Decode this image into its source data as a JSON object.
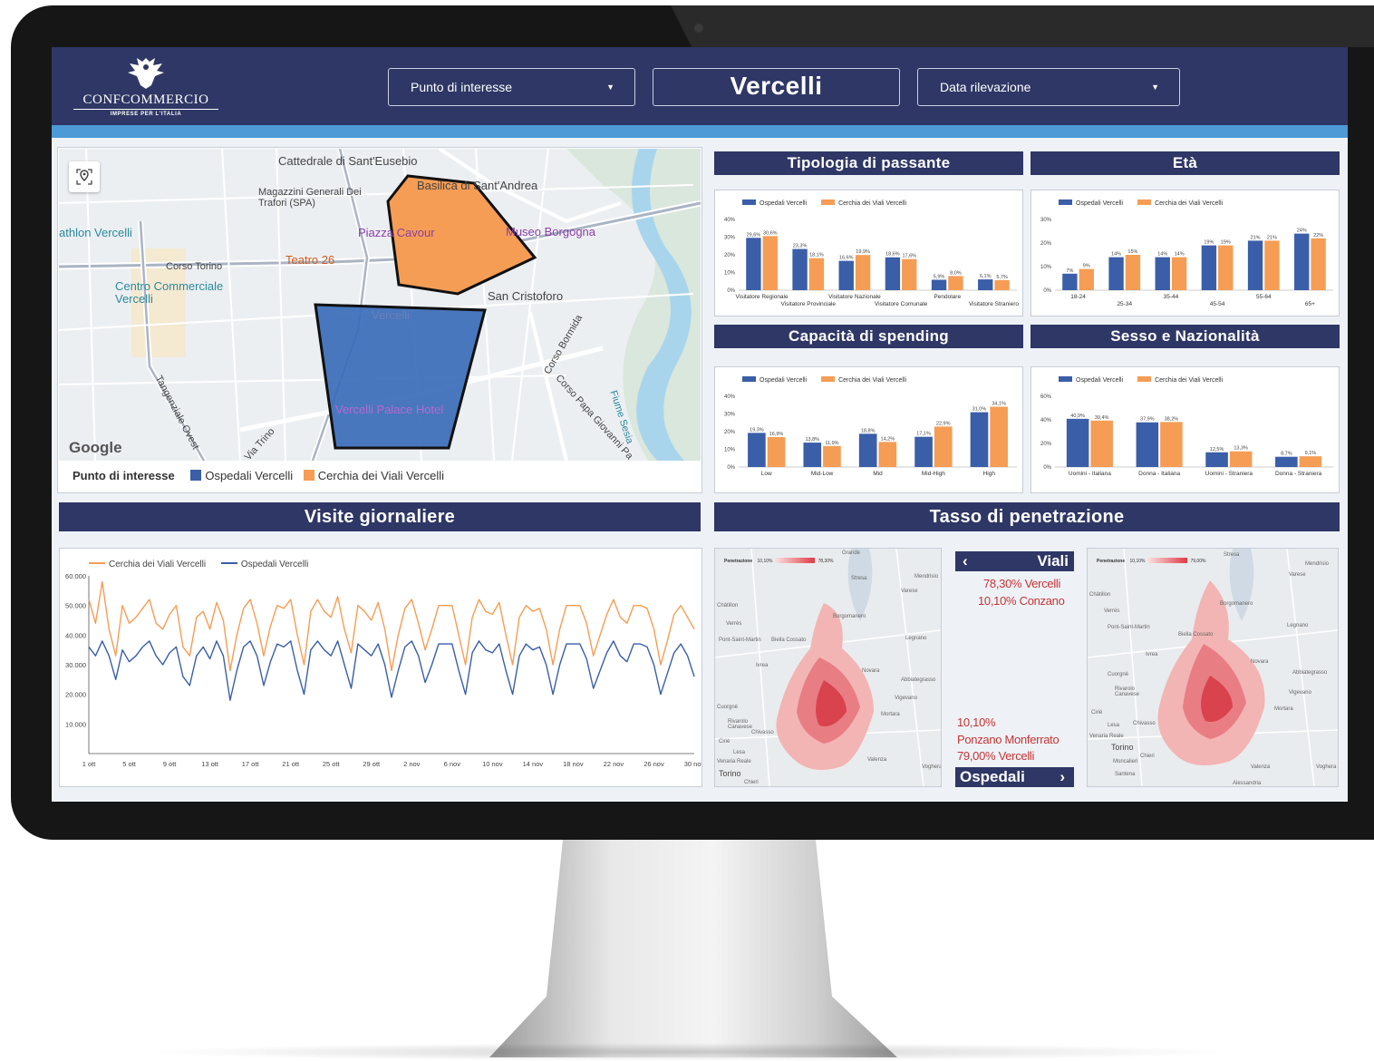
{
  "header": {
    "logo_name": "CONFCOMMERCIO",
    "logo_sub": "IMPRESE PER L'ITALIA",
    "poi_dropdown": "Punto di interesse",
    "city": "Vercelli",
    "date_dropdown": "Data rilevazione"
  },
  "map": {
    "labels": {
      "cattedrale": "Cattedrale di Sant'Eusebio",
      "basilica": "Basilica di Sant'Andrea",
      "magazzini": "Magazzini Generali Dei Trafori (SPA)",
      "athlon": "athlon Vercelli",
      "piazza": "Piazza Cavour",
      "museo": "Museo Borgogna",
      "teatro": "Teatro 26",
      "corso_torino": "Corso Torino",
      "centro": "Centro Commerciale Vercelli",
      "san_cristoforo": "San Cristoforo",
      "vercelli": "Vercelli",
      "corso_bormida": "Corso Bormida",
      "tangenziale": "Tangenziale Ovest",
      "corso_papa": "Corso Papa Giovanni Pa",
      "fiume_sesia": "Fiume Sesia",
      "palace": "Vercelli Palace Hotel",
      "via_trino": "Via Trino",
      "google": "Google"
    },
    "legend_title": "Punto di interesse",
    "legend_ospedali": "Ospedali Vercelli",
    "legend_cerchia": "Cerchia dei Viali Vercelli"
  },
  "colors": {
    "blue": "#3a5ea8",
    "orange": "#f59d55",
    "navy": "#2e3765",
    "red": "#c43433"
  },
  "sections": {
    "tipologia": "Tipologia di passante",
    "eta": "Età",
    "spending": "Capacità di spending",
    "sesso": "Sesso e Nazionalità",
    "visite": "Visite giornaliere",
    "tasso": "Tasso di penetrazione"
  },
  "series_names": {
    "ospedali": "Ospedali Vercelli",
    "cerchia": "Cerchia dei Viali Vercelli"
  },
  "chart_data": [
    {
      "id": "tipologia",
      "type": "bar",
      "title": "Tipologia di passante",
      "categories": [
        "Visitatore Regionale",
        "Visitatore Provinciale",
        "Visitatore Nazionale",
        "Visitatore Comunale",
        "Pendolare",
        "Visitatore Straniero"
      ],
      "series": [
        {
          "name": "Ospedali Vercelli",
          "values": [
            29.6,
            23.3,
            16.6,
            18.6,
            5.9,
            6.1
          ],
          "labels": [
            "29,6%",
            "23,3%",
            "16,6%",
            "18,6%",
            "5,9%",
            "6,1%"
          ]
        },
        {
          "name": "Cerchia dei Viali Vercelli",
          "values": [
            30.6,
            18.1,
            19.9,
            17.6,
            8.0,
            5.7
          ],
          "labels": [
            "30,6%",
            "18,1%",
            "19,9%",
            "17,6%",
            "8,0%",
            "5,7%"
          ]
        }
      ],
      "yticks": [
        "0%",
        "10%",
        "20%",
        "30%",
        "40%"
      ],
      "ylim": [
        0,
        40
      ]
    },
    {
      "id": "eta",
      "type": "bar",
      "title": "Età",
      "categories": [
        "18-24",
        "25-34",
        "35-44",
        "45-54",
        "55-64",
        "65+"
      ],
      "series": [
        {
          "name": "Ospedali Vercelli",
          "values": [
            7,
            14,
            14,
            19,
            21,
            24
          ],
          "labels": [
            "7%",
            "14%",
            "14%",
            "19%",
            "21%",
            "24%"
          ]
        },
        {
          "name": "Cerchia dei Viali Vercelli",
          "values": [
            9,
            15,
            14,
            19,
            21,
            22
          ],
          "labels": [
            "9%",
            "15%",
            "14%",
            "19%",
            "21%",
            "22%"
          ]
        }
      ],
      "yticks": [
        "0%",
        "10%",
        "20%",
        "30%"
      ],
      "ylim": [
        0,
        30
      ]
    },
    {
      "id": "spending",
      "type": "bar",
      "title": "Capacità di spending",
      "categories": [
        "Low",
        "Mid-Low",
        "Mid",
        "Mid-High",
        "High"
      ],
      "series": [
        {
          "name": "Ospedali Vercelli",
          "values": [
            19.3,
            13.8,
            18.8,
            17.1,
            31.0
          ],
          "labels": [
            "19,3%",
            "13,8%",
            "18,8%",
            "17,1%",
            "31,0%"
          ]
        },
        {
          "name": "Cerchia dei Viali Vercelli",
          "values": [
            16.9,
            11.9,
            14.2,
            22.9,
            34.1
          ],
          "labels": [
            "16,9%",
            "11,9%",
            "14,2%",
            "22,9%",
            "34,1%"
          ]
        }
      ],
      "yticks": [
        "0%",
        "10%",
        "20%",
        "30%",
        "40%"
      ],
      "ylim": [
        0,
        40
      ]
    },
    {
      "id": "sesso",
      "type": "bar",
      "title": "Sesso e Nazionalità",
      "categories": [
        "Uomini - Italiana",
        "Donna - Italiana",
        "Uomini - Straniera",
        "Donna - Straniera"
      ],
      "series": [
        {
          "name": "Ospedali Vercelli",
          "values": [
            40.9,
            37.9,
            12.5,
            8.7
          ],
          "labels": [
            "40,9%",
            "37,9%",
            "12,5%",
            "8,7%"
          ]
        },
        {
          "name": "Cerchia dei Viali Vercelli",
          "values": [
            39.4,
            38.2,
            13.3,
            9.1
          ],
          "labels": [
            "39,4%",
            "38,2%",
            "13,3%",
            "9,1%"
          ]
        }
      ],
      "yticks": [
        "0%",
        "20%",
        "40%",
        "60%"
      ],
      "ylim": [
        0,
        60
      ]
    },
    {
      "id": "visite",
      "type": "line",
      "title": "Visite giornaliere",
      "xticks": [
        "1 ott",
        "5 ott",
        "9 ott",
        "13 ott",
        "17 ott",
        "21 ott",
        "25 ott",
        "29 ott",
        "2 nov",
        "6 nov",
        "10 nov",
        "14 nov",
        "18 nov",
        "22 nov",
        "26 nov",
        "30 nov"
      ],
      "yticks": [
        "10.000",
        "20.000",
        "30.000",
        "40.000",
        "50.000",
        "60.000"
      ],
      "ylim": [
        0,
        60000
      ],
      "series": [
        {
          "name": "Cerchia dei Viali Vercelli",
          "values": [
            52000,
            44000,
            58000,
            42000,
            33000,
            50000,
            44000,
            46000,
            49000,
            52000,
            44000,
            42000,
            47000,
            50000,
            36000,
            33000,
            46000,
            48000,
            42000,
            51000,
            45000,
            28000,
            40000,
            49000,
            52000,
            44000,
            33000,
            43000,
            50000,
            49000,
            52000,
            40000,
            30000,
            48000,
            52000,
            48000,
            46000,
            53000,
            42000,
            34000,
            50000,
            48000,
            45000,
            51000,
            42000,
            28000,
            40000,
            49000,
            52000,
            44000,
            35000,
            42000,
            50000,
            50000,
            50000,
            40000,
            30000,
            46000,
            52000,
            48000,
            47000,
            51000,
            40000,
            30000,
            46000,
            50000,
            48000,
            49000,
            42000,
            30000,
            42000,
            50000,
            50000,
            50000,
            44000,
            33000,
            40000,
            47000,
            52000,
            46000,
            44000,
            50000,
            50000,
            49000,
            42000,
            30000,
            38000,
            47000,
            50000,
            46000,
            42000
          ]
        },
        {
          "name": "Ospedali Vercelli",
          "values": [
            36000,
            33000,
            38000,
            33000,
            25000,
            35000,
            31000,
            33000,
            36000,
            38000,
            33000,
            30000,
            34000,
            36000,
            26000,
            23000,
            33000,
            36000,
            32000,
            38000,
            33000,
            18000,
            28000,
            36000,
            38000,
            33000,
            23000,
            31000,
            37000,
            36000,
            38000,
            28000,
            20000,
            35000,
            38000,
            35000,
            33000,
            38000,
            30000,
            22000,
            37000,
            35000,
            33000,
            37000,
            30000,
            19000,
            28000,
            36000,
            38000,
            33000,
            24000,
            30000,
            37000,
            37000,
            37000,
            28000,
            20000,
            34000,
            38000,
            35000,
            34000,
            37000,
            28000,
            20000,
            33000,
            37000,
            35000,
            36000,
            30000,
            20000,
            30000,
            37000,
            37000,
            37000,
            32000,
            22000,
            28000,
            34000,
            38000,
            33000,
            31000,
            37000,
            37000,
            36000,
            30000,
            20000,
            27000,
            34000,
            37000,
            33000,
            26000
          ]
        }
      ]
    }
  ],
  "tasso": {
    "viali_nav": "Viali",
    "viali_line1": "78,30% Vercelli",
    "viali_line2": "10,10% Conzano",
    "osp_line1": "10,10%",
    "osp_line2": "Ponzano Monferrato",
    "osp_line3": "79,00% Vercelli",
    "osp_nav": "Ospedali",
    "left_map_legend": "Penetrazione",
    "left_map_min": "10,10%",
    "left_map_max": "78,30%",
    "right_map_legend": "Penetrazione",
    "right_map_min": "10,10%",
    "right_map_max": "79,00%",
    "towns": {
      "grande": "Grande",
      "mendrisio": "Mendrisio",
      "varese": "Varese",
      "biella": "Biella Cossato",
      "borgomanero": "Borgomanero",
      "ivrea": "Ivrea",
      "novara": "Novara",
      "torino": "Torino",
      "vigevano": "Vigevano",
      "mortara": "Mortara",
      "legnano": "Legnano",
      "chivasso": "Chivasso",
      "abbiategrasso": "Abbiategrasso",
      "cuorgne": "Cuorgnè",
      "valenza": "Valenza",
      "alessandria": "Alessandria",
      "santhia": "Santhià",
      "voghera": "Voghera",
      "moncalieri": "Moncalieri",
      "ciriè": "Ciriè",
      "rivarolo": "Rivarolo Canavese",
      "pont": "Pont-Saint-Martin",
      "lesa": "Lesa",
      "chieri": "Chieri",
      "stresa": "Stresa",
      "chiasso": "Chiasso",
      "venaria": "Venaria Reale",
      "verres": "Verrès",
      "chatillon": "Châtillon",
      "serravalle": "Santena"
    }
  }
}
